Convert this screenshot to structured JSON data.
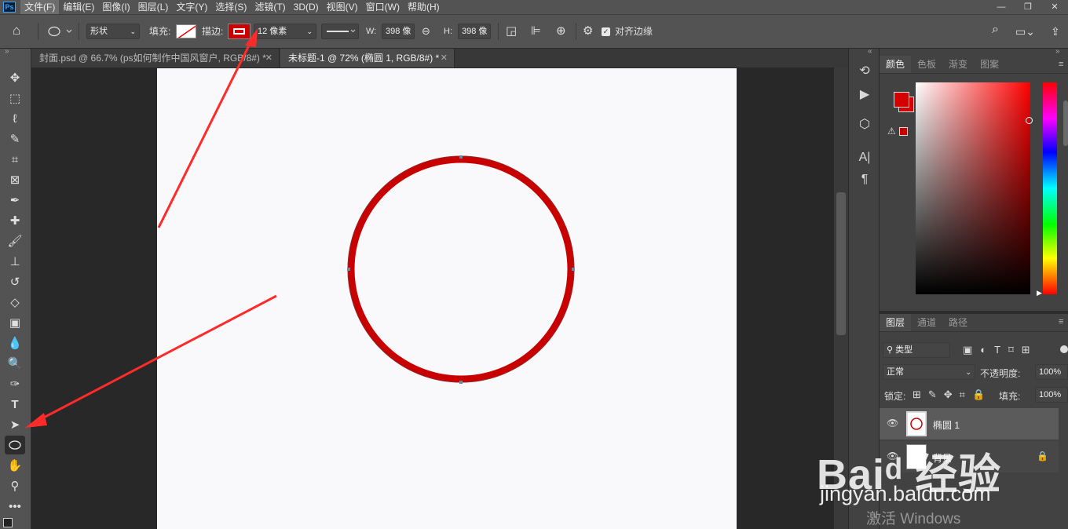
{
  "app": {
    "logo": "Ps"
  },
  "menu": [
    "文件(F)",
    "编辑(E)",
    "图像(I)",
    "图层(L)",
    "文字(Y)",
    "选择(S)",
    "滤镜(T)",
    "3D(D)",
    "视图(V)",
    "窗口(W)",
    "帮助(H)"
  ],
  "window_controls": {
    "minimize": "—",
    "restore": "❐",
    "close": "✕"
  },
  "options": {
    "mode": "形状",
    "fill_label": "填充:",
    "stroke_label": "描边:",
    "stroke_width": "12 像素",
    "w_label": "W:",
    "w_value": "398 像",
    "h_label": "H:",
    "h_value": "398 像",
    "align_edges": "对齐边缘"
  },
  "tabs": [
    {
      "label": "封面.psd @ 66.7% (ps如何制作中国风窗户, RGB/8#) *"
    },
    {
      "label": "未标题-1 @ 72% (椭圆 1, RGB/8#) *"
    }
  ],
  "panels": {
    "color_tabs": [
      "颜色",
      "色板",
      "渐变",
      "图案"
    ],
    "layer_tabs": [
      "图层",
      "通道",
      "路径"
    ],
    "filter_kind": "类型",
    "blend_mode": "正常",
    "opacity_label": "不透明度:",
    "opacity_value": "100%",
    "lock_label": "锁定:",
    "fill_label": "填充:",
    "fill_value": "100%",
    "layers": [
      {
        "name": "椭圆 1"
      },
      {
        "name": "背景"
      }
    ]
  },
  "colors": {
    "foreground": "#d40000",
    "stroke": "#c80000",
    "accent": "#ff2a2a"
  },
  "watermark": {
    "brand": "Baiᵈ 经验",
    "url": "jingyan.baidu.com",
    "activate": "激活 Windows"
  }
}
